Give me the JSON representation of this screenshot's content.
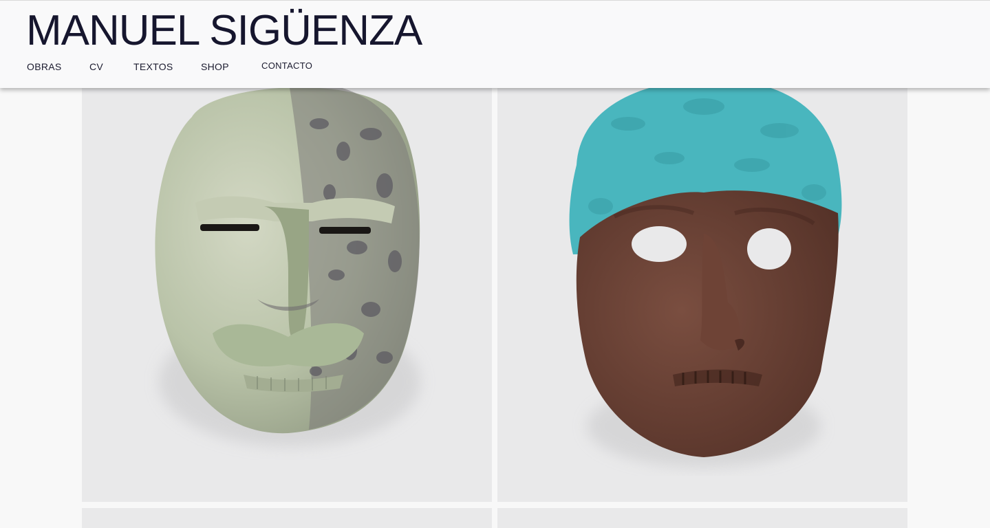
{
  "site": {
    "title": "MANUEL SIGÜENZA"
  },
  "nav": {
    "items": [
      {
        "label": "OBRAS"
      },
      {
        "label": "CV"
      },
      {
        "label": "TEXTOS"
      },
      {
        "label": "SHOP"
      },
      {
        "label": "CONTACTO"
      }
    ]
  },
  "gallery": {
    "items": [
      {
        "subject": "green-ceramic-mask",
        "colors": {
          "glaze": "#b7c3a5",
          "shadow": "#6f6c70"
        }
      },
      {
        "subject": "brown-turquoise-mask",
        "colors": {
          "hair": "#46b4bc",
          "face": "#6b4236"
        }
      },
      {
        "subject": "artwork"
      },
      {
        "subject": "artwork"
      }
    ]
  },
  "colors": {
    "background": "#f8f8f8",
    "header": "#f9f9fa",
    "title_text": "#16162e",
    "tile": "#e9e9ea"
  }
}
